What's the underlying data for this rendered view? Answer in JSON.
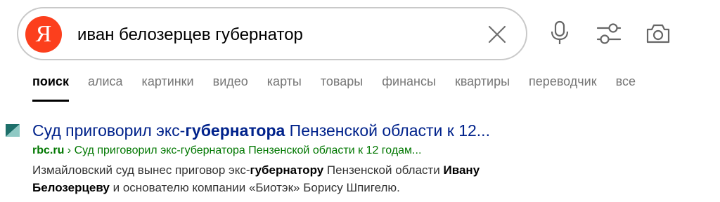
{
  "search": {
    "logo_letter": "Я",
    "query": "иван белозерцев губернатор"
  },
  "icons": {
    "clear": "close-icon",
    "voice": "microphone-icon",
    "settings": "sliders-icon",
    "image_search": "camera-icon"
  },
  "colors": {
    "logo": "#fc3f1d",
    "link": "#00228b",
    "url": "#007700",
    "tab_inactive": "#767676"
  },
  "tabs": [
    {
      "label": "поиск",
      "active": true
    },
    {
      "label": "алиса"
    },
    {
      "label": "картинки"
    },
    {
      "label": "видео"
    },
    {
      "label": "карты"
    },
    {
      "label": "товары"
    },
    {
      "label": "финансы"
    },
    {
      "label": "квартиры"
    },
    {
      "label": "переводчик"
    },
    {
      "label": "все"
    }
  ],
  "result": {
    "title_before": "Суд приговорил экс-",
    "title_bold": "губернатора",
    "title_after": " Пензенской области к 12...",
    "url_domain": "rbc.ru",
    "url_path": " › Суд приговорил экс-губернатора Пензенской области к 12 годам...",
    "snippet_1": "Измайловский суд вынес приговор экс-",
    "snippet_bold_1": "губернатору",
    "snippet_2": " Пензенской области ",
    "snippet_bold_2": "Ивану Белозерцеву",
    "snippet_3": " и основателю компании «Биотэк» Борису Шпигелю."
  }
}
